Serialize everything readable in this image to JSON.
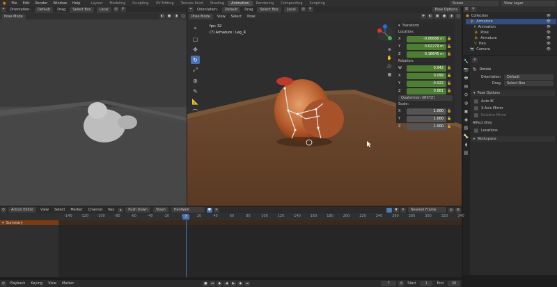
{
  "topbar": {
    "menus": [
      "File",
      "Edit",
      "Render",
      "Window",
      "Help"
    ],
    "workspaces": [
      "Layout",
      "Modeling",
      "Sculpting",
      "UV Editing",
      "Texture Paint",
      "Shading",
      "Animation",
      "Rendering",
      "Compositing",
      "Scripting"
    ],
    "active_workspace": "Animation",
    "scene": "Scene",
    "view_layer": "View Layer"
  },
  "left_viewport": {
    "orientation_label": "Orientation:",
    "orientation": "Default",
    "drag_label": "Drag",
    "drag": "Select Box",
    "transform": "Local",
    "mode": "Pose Mode"
  },
  "main_viewport": {
    "orientation_label": "Orientation:",
    "orientation": "Default",
    "drag_label": "Drag",
    "drag": "Select Box",
    "transform": "Local",
    "pose_options": "Pose Options",
    "mode": "Pose Mode",
    "menus": [
      "View",
      "Select",
      "Pose"
    ],
    "fps": "fps: 32",
    "object": "(7) Armature : Leg_R"
  },
  "transform_panel": {
    "title": "Transform",
    "location_label": "Location:",
    "location": [
      {
        "axis": "X",
        "value": "-0.06666 m"
      },
      {
        "axis": "Y",
        "value": "0.02279 m"
      },
      {
        "axis": "Z",
        "value": "0.18645 m"
      }
    ],
    "rotation_label": "Rotation:",
    "rotation": [
      {
        "axis": "W",
        "value": "0.942"
      },
      {
        "axis": "X",
        "value": "0.099"
      },
      {
        "axis": "Y",
        "value": "-0.022"
      },
      {
        "axis": "Z",
        "value": "0.881"
      }
    ],
    "rotation_mode": "Quaternion (WXYZ)",
    "scale_label": "Scale:",
    "scale": [
      {
        "axis": "X",
        "value": "1.000"
      },
      {
        "axis": "Y",
        "value": "1.000"
      },
      {
        "axis": "Z",
        "value": "1.000"
      }
    ]
  },
  "outliner": {
    "items": [
      {
        "label": "Collection",
        "depth": 0
      },
      {
        "label": "Armature",
        "depth": 1,
        "selected": true
      },
      {
        "label": "Animation",
        "depth": 2
      },
      {
        "label": "Pose",
        "depth": 2
      },
      {
        "label": "Armature",
        "depth": 2
      },
      {
        "label": "Hen",
        "depth": 2
      },
      {
        "label": "Camera",
        "depth": 1
      }
    ]
  },
  "properties": {
    "tool": "Rotate",
    "orientation_label": "Orientation",
    "orientation": "Default",
    "drag_label": "Drag",
    "drag": "Select Box",
    "pose_options": "Pose Options",
    "auto_ik": "Auto IK",
    "x_axis_mirror": "X-Axis Mirror",
    "relative_mirror": "Relative Mirror",
    "affect_only": "Affect Only",
    "locations": "Locations",
    "workspace": "Workspace"
  },
  "action_editor": {
    "mode": "Action Editor",
    "menus": [
      "View",
      "Select",
      "Marker",
      "Channel",
      "Key"
    ],
    "push_down": "Push Down",
    "stash": "Stash",
    "action": "HenWalk",
    "snap": "Nearest Frame",
    "summary": "Summary",
    "ticks": [
      "-140",
      "-120",
      "-100",
      "-80",
      "-60",
      "-40",
      "-20",
      "0",
      "20",
      "40",
      "60",
      "80",
      "100",
      "120",
      "140",
      "160",
      "180",
      "200",
      "220",
      "240",
      "260",
      "280",
      "300",
      "320",
      "340"
    ],
    "current_frame": "7"
  },
  "timeline": {
    "menus": [
      "Playback",
      "Keying",
      "View",
      "Marker"
    ],
    "frame": "7",
    "start_label": "Start",
    "start": "1",
    "end_label": "End",
    "end": "20"
  },
  "colors": {
    "accent": "#4772b3",
    "green": "#4e7d34"
  }
}
